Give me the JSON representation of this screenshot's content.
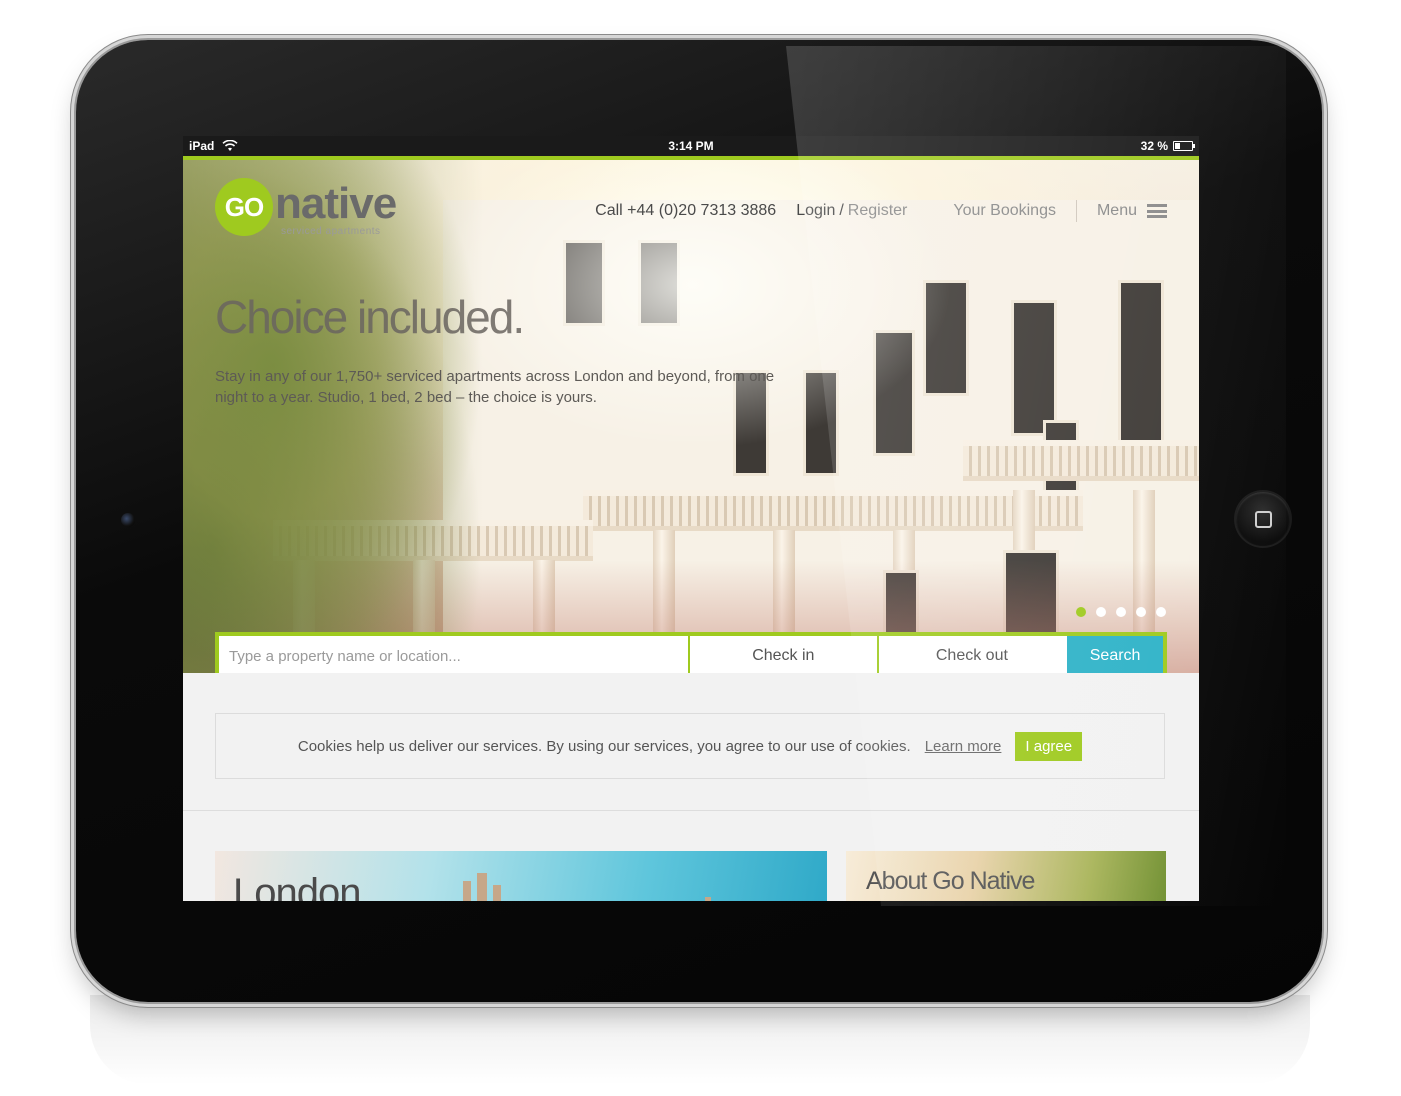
{
  "statusbar": {
    "device": "iPad",
    "time": "3:14 PM",
    "battery": "32 %",
    "battery_level": 0.32
  },
  "header": {
    "logo_go": "GO",
    "logo_word": "native",
    "logo_tagline": "serviced apartments",
    "phone": "Call +44 (0)20 7313 3886",
    "login": "Login",
    "slash": "/",
    "register": "Register",
    "bookings": "Your Bookings",
    "menu": "Menu"
  },
  "hero": {
    "title": "Choice included.",
    "text": "Stay in any of our 1,750+ serviced apartments across London and beyond, from one night to a year. Studio, 1 bed, 2 bed – the choice is yours.",
    "active_slide": 1,
    "slide_count": 5
  },
  "search": {
    "placeholder": "Type a property name or location...",
    "check_in": "Check in",
    "check_out": "Check out",
    "button": "Search"
  },
  "cookie": {
    "text": "Cookies help us deliver our services. By using our services, you agree to our use of cookies.",
    "learn_more": "Learn more",
    "agree": "I agree"
  },
  "cards": {
    "london": "London",
    "about": "About Go Native"
  },
  "colors": {
    "brand_green": "#9fca1f",
    "search_blue": "#2fb3c8"
  }
}
